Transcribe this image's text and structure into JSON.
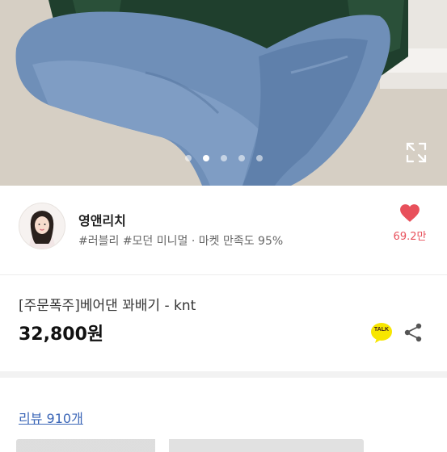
{
  "carousel": {
    "count": 5,
    "active_index": 1
  },
  "seller": {
    "name": "영앤리치",
    "tags": "#러블리 #모던 미니멀 · 마켓 만족도 95%",
    "likes": "69.2만"
  },
  "product": {
    "title": "[주문폭주]베어댄 꽈배기 - knt",
    "price": "32,800원",
    "talk_badge": "TALK"
  },
  "reviews": {
    "label": "리뷰 910개"
  },
  "colors": {
    "accent": "#e8505b",
    "link": "#3b66b7",
    "talk": "#f7e600"
  },
  "icons": [
    "expand-icon",
    "heart-icon",
    "kakaotalk-icon",
    "share-icon"
  ]
}
